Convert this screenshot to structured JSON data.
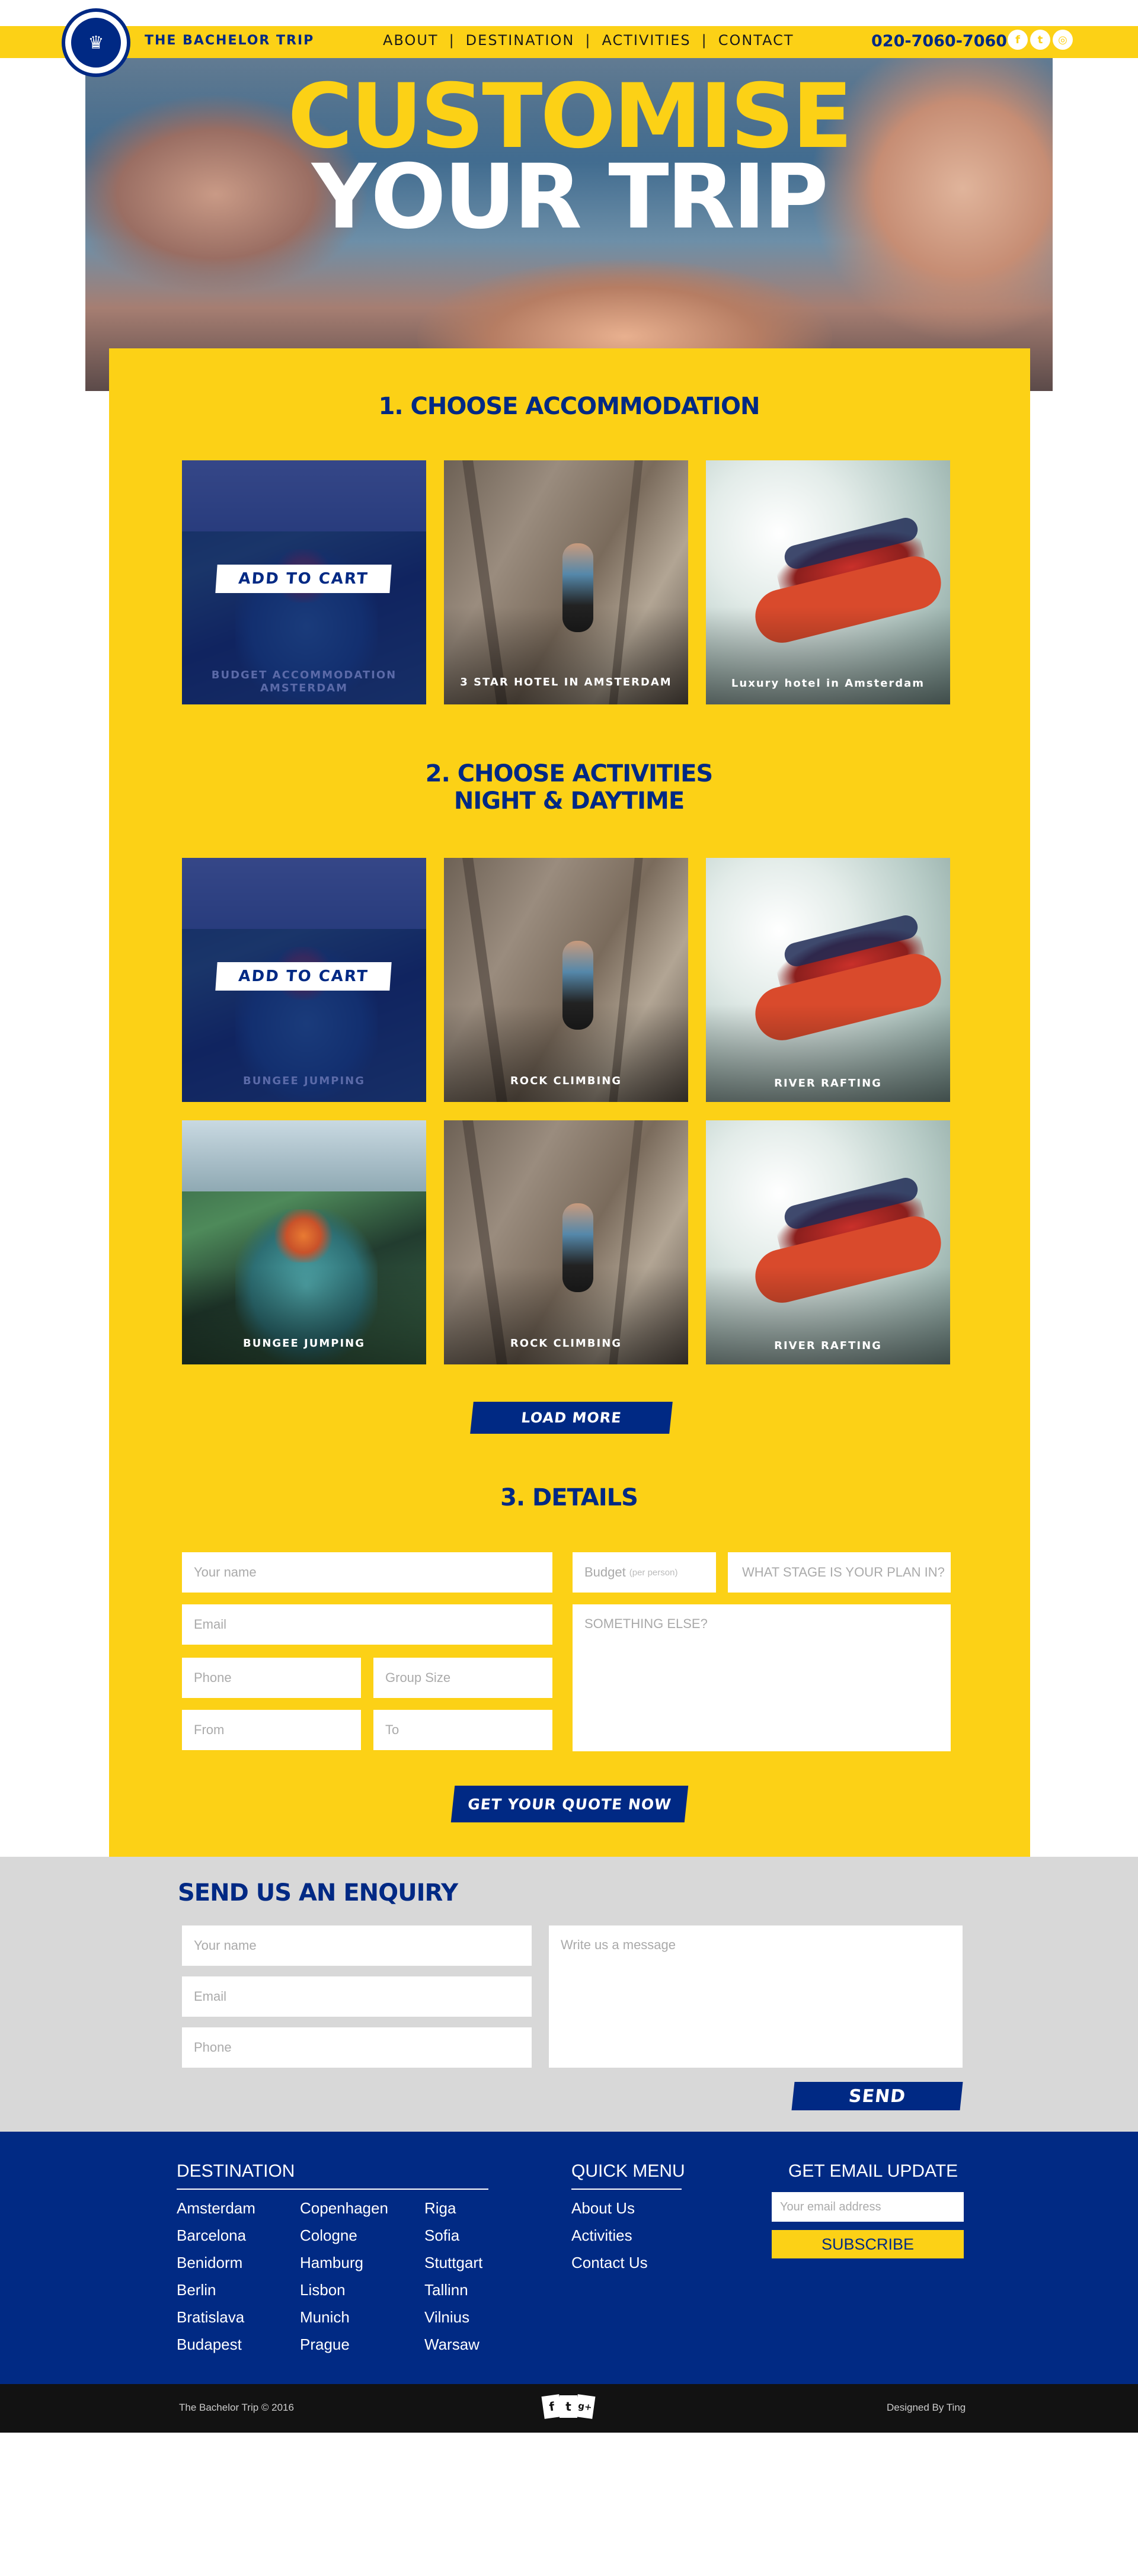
{
  "header": {
    "brand": "THE BACHELOR TRIP",
    "nav": [
      "ABOUT",
      "DESTINATION",
      "ACTIVITIES",
      "CONTACT"
    ],
    "nav_separator": "|",
    "phone": "020-7060-7060",
    "social_icons": [
      "facebook-icon",
      "twitter-icon",
      "instagram-icon"
    ],
    "social_glyphs": [
      "f",
      "t",
      "◎"
    ],
    "logo_glyph": "♛"
  },
  "hero": {
    "title_line1": "CUSTOMISE",
    "title_line2": "YOUR TRIP"
  },
  "accommodation": {
    "title": "1. CHOOSE ACCOMMODATION",
    "add_to_cart": "ADD TO CART",
    "items": [
      "BUDGET ACCOMMODATION AMSTERDAM",
      "3 STAR HOTEL IN AMSTERDAM",
      "Luxury hotel in Amsterdam"
    ]
  },
  "activities": {
    "title_line1": "2. CHOOSE ACTIVITIES",
    "title_line2": "NIGHT & DAYTIME",
    "add_to_cart": "ADD TO CART",
    "items": [
      "BUNGEE JUMPING",
      "ROCK CLIMBING",
      "RIVER RAFTING",
      "BUNGEE JUMPING",
      "ROCK CLIMBING",
      "RIVER RAFTING"
    ],
    "load_more": "LOAD MORE"
  },
  "details": {
    "title": "3. DETAILS",
    "your_name": "Your name",
    "email": "Email",
    "phone": "Phone",
    "group_size": "Group Size",
    "from": "From",
    "to": "To",
    "budget": "Budget",
    "budget_note": "(per person)",
    "stage": "WHAT STAGE IS YOUR PLAN IN?",
    "something_else": "SOMETHING ELSE?",
    "submit": "GET YOUR QUOTE NOW"
  },
  "enquiry": {
    "title": "SEND US AN ENQUIRY",
    "your_name": "Your name",
    "email": "Email",
    "phone": "Phone",
    "message": "Write us a message",
    "send": "SEND"
  },
  "footer": {
    "destination_title": "DESTINATION",
    "destinations_col1": [
      "Amsterdam",
      "Barcelona",
      "Benidorm",
      "Berlin",
      "Bratislava",
      "Budapest"
    ],
    "destinations_col2": [
      "Copenhagen",
      "Cologne",
      "Hamburg",
      "Lisbon",
      "Munich",
      "Prague"
    ],
    "destinations_col3": [
      "Riga",
      "Sofia",
      "Stuttgart",
      "Tallinn",
      "Vilnius",
      "Warsaw"
    ],
    "quick_menu_title": "QUICK MENU",
    "quick_menu": [
      "About Us",
      "Activities",
      "Contact Us"
    ],
    "email_update_title": "GET EMAIL UPDATE",
    "email_placeholder": "Your email address",
    "subscribe": "SUBSCRIBE"
  },
  "bottom": {
    "copyright": "The Bachelor Trip © 2016",
    "designed_by": "Designed By Ting",
    "card_icons": [
      "f",
      "t",
      "g+"
    ]
  },
  "colors": {
    "yellow": "#fcd116",
    "navy": "#002984",
    "grey": "#d8d8d8",
    "dark": "#121212"
  }
}
